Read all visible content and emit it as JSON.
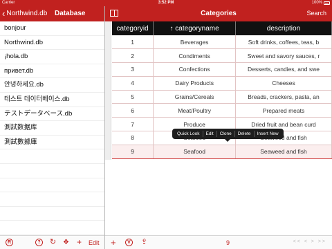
{
  "status_bar": {
    "carrier": "Carrier",
    "time": "3:52 PM",
    "battery": "100%"
  },
  "left_panel": {
    "back_label": "Northwind.db",
    "title": "Database",
    "databases": [
      "bonjour",
      "Northwind.db",
      "¡hola.db",
      "привет.db",
      "안녕하세요.db",
      "테스트 데이터베이스.db",
      "テストデータベース.db",
      "測試数据库",
      "測試數據庫"
    ],
    "toolbar": {
      "edit_label": "Edit",
      "icons": [
        "registered-icon",
        "help-icon",
        "refresh-icon",
        "dropbox-icon",
        "add-icon"
      ]
    }
  },
  "right_panel": {
    "title": "Categories",
    "search_label": "Search",
    "columns": [
      "categoryid",
      "↑ categoryname",
      "description"
    ],
    "rows": [
      [
        "1",
        "Beverages",
        "Soft drinks, coffees, teas, b"
      ],
      [
        "2",
        "Condiments",
        "Sweet and savory sauces, r"
      ],
      [
        "3",
        "Confections",
        "Desserts, candies, and swe"
      ],
      [
        "4",
        "Dairy Products",
        "Cheeses"
      ],
      [
        "5",
        "Grains/Cereals",
        "Breads, crackers, pasta, an"
      ],
      [
        "6",
        "Meat/Poultry",
        "Prepared meats"
      ],
      [
        "7",
        "Produce",
        "Dried fruit and bean curd"
      ],
      [
        "8",
        "Seafood",
        "Seaweed and fish"
      ],
      [
        "9",
        "Seafood",
        "Seaweed and fish"
      ]
    ],
    "selected_row_index": 8,
    "context_menu": [
      "Quick Look",
      "Edit",
      "Clone",
      "Delete",
      "Insert New"
    ],
    "toolbar": {
      "page_number": "9",
      "pager_arrows": [
        "<<",
        "<",
        ">",
        ">>"
      ]
    }
  },
  "colors": {
    "brand_red": "#c1211f",
    "header_black": "#111111"
  }
}
